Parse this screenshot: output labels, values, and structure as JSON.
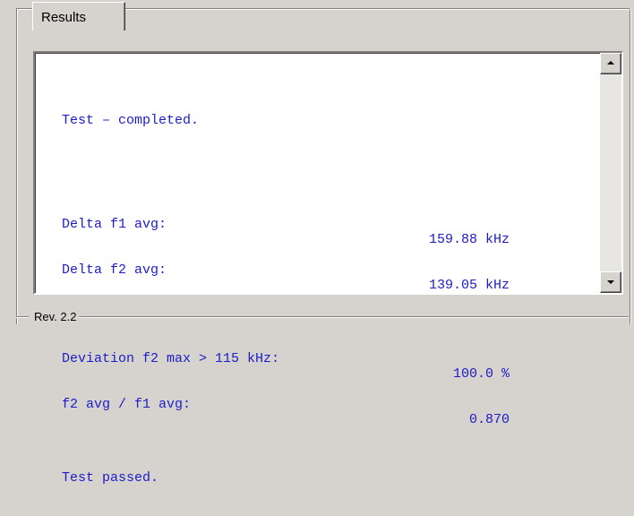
{
  "group": {
    "title": "Results",
    "footer": "Rev. 2.2"
  },
  "output": {
    "status_line": "Test – completed.",
    "delta_f1_label": "Delta f1 avg:",
    "delta_f1_value": "159.88 kHz",
    "delta_f2_label": "Delta f2 avg:",
    "delta_f2_value": "139.05 kHz",
    "deviation_label": "Deviation f2 max > 115 kHz:",
    "deviation_value": "100.0 %",
    "ratio_label": "f2 avg / f1 avg:",
    "ratio_value": "0.870",
    "result_line": "Test passed."
  },
  "colors": {
    "text": "#1c1cc8",
    "background": "#d6d3ce"
  },
  "icons": {
    "scroll_up": "arrow-up-icon",
    "scroll_down": "arrow-down-icon"
  }
}
